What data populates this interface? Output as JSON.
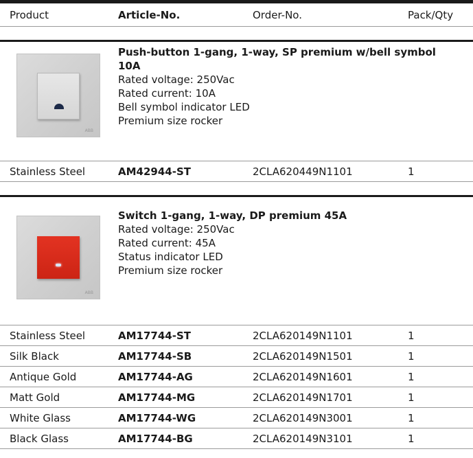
{
  "header": {
    "product": "Product",
    "article": "Article-No.",
    "order": "Order-No.",
    "pack": "Pack/Qty"
  },
  "section1": {
    "title": "Push-button 1-gang, 1-way, SP premium w/bell symbol 10A",
    "specs": [
      "Rated voltage: 250Vac",
      "Rated current: 10A",
      "Bell symbol indicator LED",
      "Premium size rocker"
    ],
    "image_logo": "ABB",
    "rows": [
      {
        "finish": "Stainless Steel",
        "article": "AM42944-ST",
        "order": "2CLA620449N1101",
        "qty": "1"
      }
    ]
  },
  "section2": {
    "title": "Switch 1-gang, 1-way, DP premium 45A",
    "specs": [
      "Rated voltage: 250Vac",
      "Rated current: 45A",
      "Status indicator LED",
      "Premium size rocker"
    ],
    "image_logo": "ABB",
    "rows": [
      {
        "finish": "Stainless Steel",
        "article": "AM17744-ST",
        "order": "2CLA620149N1101",
        "qty": "1"
      },
      {
        "finish": "Silk Black",
        "article": "AM17744-SB",
        "order": "2CLA620149N1501",
        "qty": "1"
      },
      {
        "finish": "Antique Gold",
        "article": "AM17744-AG",
        "order": "2CLA620149N1601",
        "qty": "1"
      },
      {
        "finish": "Matt Gold",
        "article": "AM17744-MG",
        "order": "2CLA620149N1701",
        "qty": "1"
      },
      {
        "finish": "White Glass",
        "article": "AM17744-WG",
        "order": "2CLA620149N3001",
        "qty": "1"
      },
      {
        "finish": "Black Glass",
        "article": "AM17744-BG",
        "order": "2CLA620149N3101",
        "qty": "1"
      }
    ]
  },
  "colors": {
    "rule_dark": "#1a1a1a",
    "rule_light": "#9a9a9a",
    "rocker_red": "#d92b1a",
    "bell_blue": "#1c2a48"
  }
}
